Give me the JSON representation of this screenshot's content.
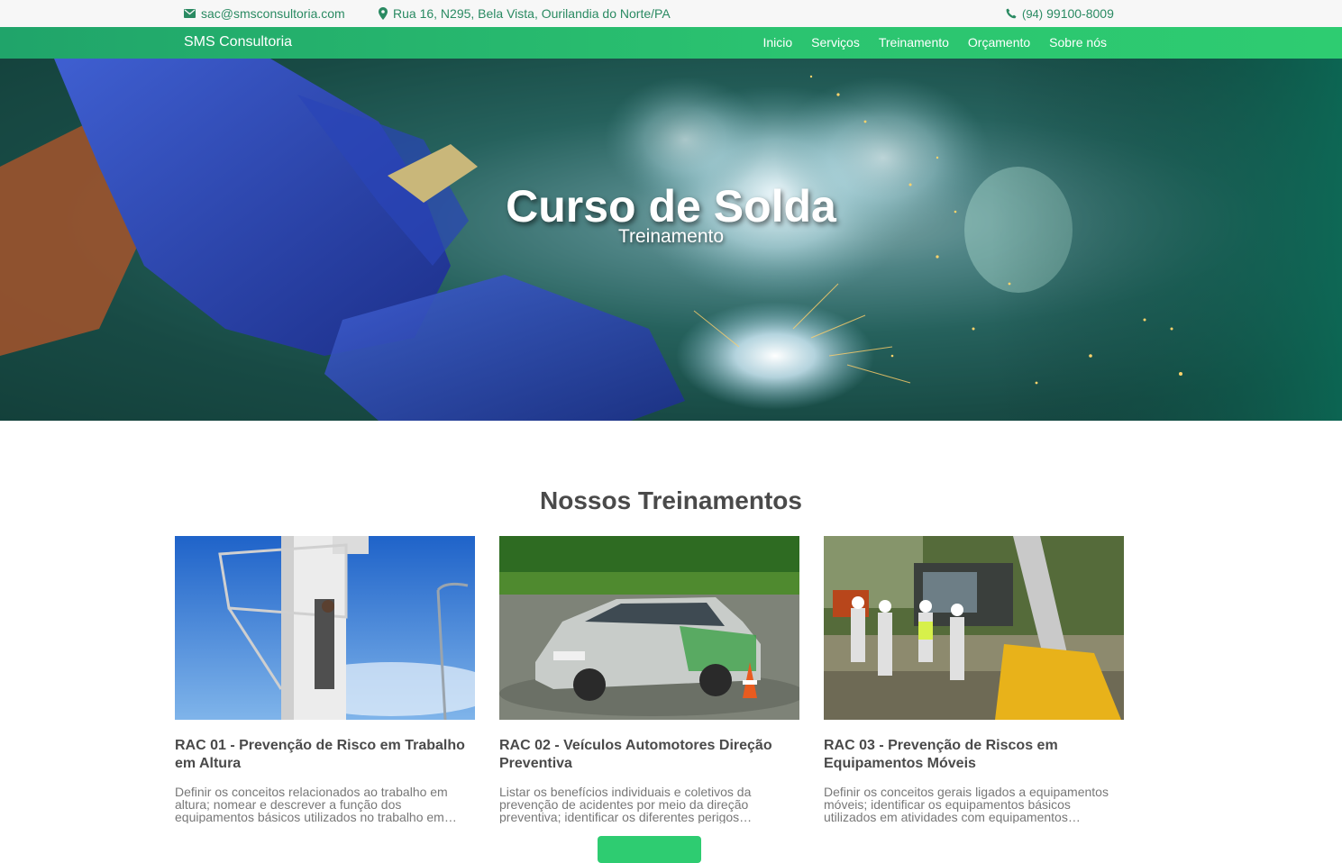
{
  "topbar": {
    "email": "sac@smsconsultoria.com",
    "address": "Rua 16, N295, Bela Vista, Ourilandia do Norte/PA",
    "phone_prefix": "(94)",
    "phone_number": "99100-8009",
    "icons": [
      "mail-icon",
      "map-pin-icon",
      "phone-icon"
    ]
  },
  "navbar": {
    "brand": "SMS Consultoria",
    "links": [
      "Inicio",
      "Serviços",
      "Treinamento",
      "Orçamento",
      "Sobre nós"
    ]
  },
  "hero": {
    "title": "Curso de Solda",
    "subtitle": "Treinamento"
  },
  "section": {
    "title": "Nossos Treinamentos"
  },
  "cards": [
    {
      "title": "RAC 01 - Prevenção de Risco em Trabalho em Altura",
      "description": "Definir os conceitos relacionados ao trabalho em altura; nomear e descrever a função dos equipamentos básicos utilizados no trabalho em…"
    },
    {
      "title": "RAC 02 - Veículos Automotores Direção Preventiva",
      "description": "Listar os benefícios individuais e coletivos da prevenção de acidentes por meio da direção preventiva; identificar os diferentes perigos…"
    },
    {
      "title": "RAC 03 - Prevenção de Riscos em Equipamentos Móveis",
      "description": "Definir os conceitos gerais ligados a equipamentos móveis; identificar os equipamentos básicos utilizados em atividades com equipamentos…"
    }
  ],
  "colors": {
    "accent": "#2ecc71",
    "nav_gradient_start": "#20a46a",
    "text_dark": "#4a4a4a",
    "text_muted": "#777777",
    "topbar_text": "#2a8a62"
  }
}
